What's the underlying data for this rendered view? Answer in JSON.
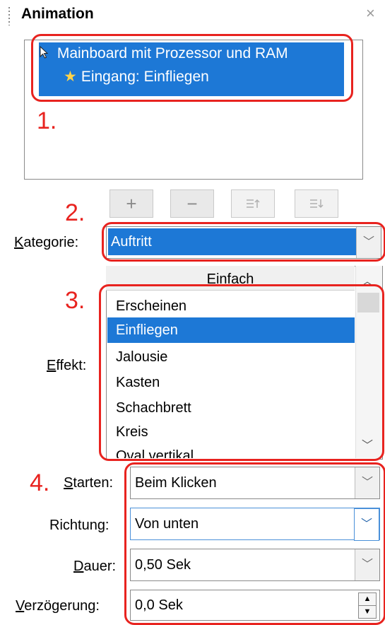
{
  "panel": {
    "title": "Animation",
    "close_glyph": "×"
  },
  "animation_list": [
    {
      "text": "Mainboard mit Prozessor und RAM",
      "icon": "cursor-icon"
    },
    {
      "text": "Eingang: Einfliegen",
      "icon": "star-icon"
    }
  ],
  "callouts": {
    "n1": "1.",
    "n2": "2.",
    "n3": "3.",
    "n4": "4."
  },
  "toolbar": {
    "add": "+",
    "remove": "−",
    "move_up": "⇞",
    "move_down": "⇟"
  },
  "kategorie": {
    "label_prefix": "K",
    "label_rest": "ategorie:",
    "value": "Auftritt"
  },
  "effekt": {
    "label_prefix": "E",
    "label_rest": "ffekt:",
    "group_header": "Einfach",
    "items": [
      "Erscheinen",
      "Einfliegen",
      "Jalousie",
      "Kasten",
      "Schachbrett",
      "Kreis",
      "Oval vertikal"
    ],
    "selected_index": 1
  },
  "starten": {
    "label_prefix": "S",
    "label_rest": "tarten:",
    "value": "Beim Klicken"
  },
  "richtung": {
    "label": "Richtung:",
    "value": "Von unten"
  },
  "dauer": {
    "label_prefix": "D",
    "label_rest": "auer:",
    "value": "0,50 Sek"
  },
  "verzoegerung": {
    "label_prefix": "V",
    "label_rest": "erzögerung:",
    "value": "0,0 Sek"
  },
  "colors": {
    "selection": "#1d78d6",
    "callout": "#e8231f",
    "star": "#ffd34a"
  }
}
